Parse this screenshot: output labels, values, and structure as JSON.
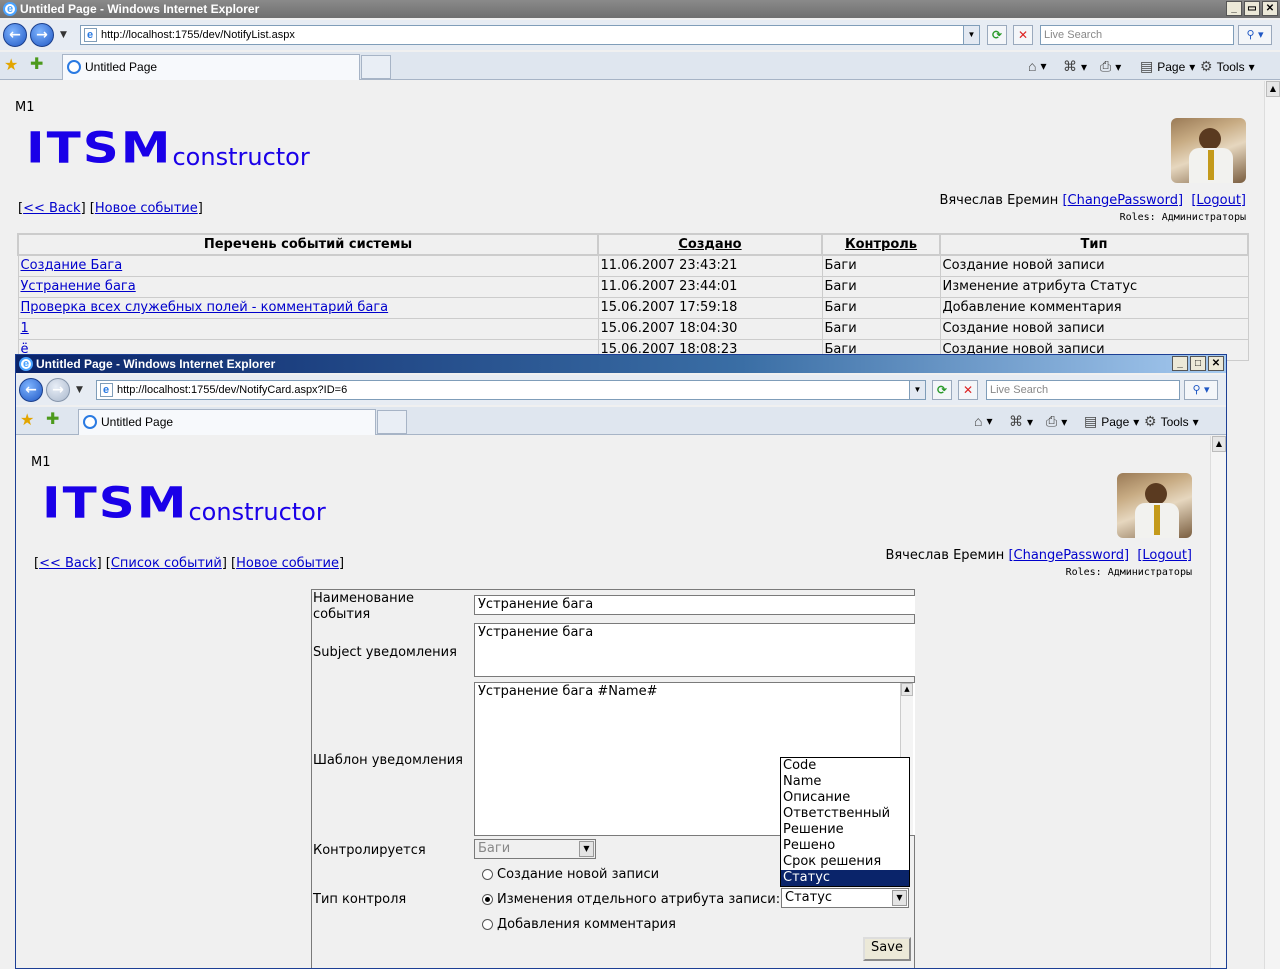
{
  "back_window": {
    "title": "Untitled Page - Windows Internet Explorer",
    "url": "http://localhost:1755/dev/NotifyList.aspx",
    "search_placeholder": "Live Search",
    "tab_title": "Untitled Page",
    "cmd_page": "Page",
    "cmd_tools": "Tools",
    "page": {
      "m1": "M1",
      "logo_main": "ITSM",
      "logo_sub": "constructor",
      "links": {
        "back": "<< Back",
        "new_event": "Новое событие"
      },
      "user_name": "Вячеслав Еремин",
      "change_password": "[ChangePassword]",
      "logout": "[Logout]",
      "roles": "Roles: Администраторы",
      "table": {
        "headers": [
          "Перечень событий системы",
          "Создано",
          "Контроль",
          "Тип"
        ],
        "rows": [
          [
            "Создание Бага",
            "11.06.2007 23:43:21",
            "Баги",
            "Создание новой записи"
          ],
          [
            "Устранение бага",
            "11.06.2007 23:44:01",
            "Баги",
            "Изменение атрибута Статус"
          ],
          [
            "Проверка всех служебных полей - комментарий бага",
            "15.06.2007 17:59:18",
            "Баги",
            "Добавление комментария"
          ],
          [
            "1",
            "15.06.2007 18:04:30",
            "Баги",
            "Создание новой записи"
          ],
          [
            "ё",
            "15.06.2007 18:08:23",
            "Баги",
            "Создание новой записи"
          ]
        ]
      }
    }
  },
  "front_window": {
    "title": "Untitled Page - Windows Internet Explorer",
    "url": "http://localhost:1755/dev/NotifyCard.aspx?ID=6",
    "search_placeholder": "Live Search",
    "tab_title": "Untitled Page",
    "cmd_page": "Page",
    "cmd_tools": "Tools",
    "page": {
      "m1": "M1",
      "logo_main": "ITSM",
      "logo_sub": "constructor",
      "links": {
        "back": "<< Back",
        "events_list": "Список событий",
        "new_event": "Новое событие"
      },
      "user_name": "Вячеслав Еремин",
      "change_password": "[ChangePassword]",
      "logout": "[Logout]",
      "roles": "Roles: Администраторы",
      "form": {
        "name_label": "Наименование события",
        "name_value": "Устранение бага",
        "subject_label": "Subject уведомления",
        "subject_value": "Устранение бага",
        "template_label": "Шаблон уведомления",
        "template_value": "Устранение бага #Name#",
        "controlled_label": "Контролируется",
        "controlled_value": "Баги",
        "control_type_label": "Тип контроля",
        "radio_new": "Создание новой записи",
        "radio_attr": "Изменения отдельного атрибута записи:",
        "radio_comment": "Добавления комментария",
        "attr_select_value": "Статус",
        "attr_options": [
          "Code",
          "Name",
          "Описание",
          "Ответственный",
          "Решение",
          "Решено",
          "Срок решения",
          "Статус"
        ],
        "save": "Save"
      }
    }
  }
}
